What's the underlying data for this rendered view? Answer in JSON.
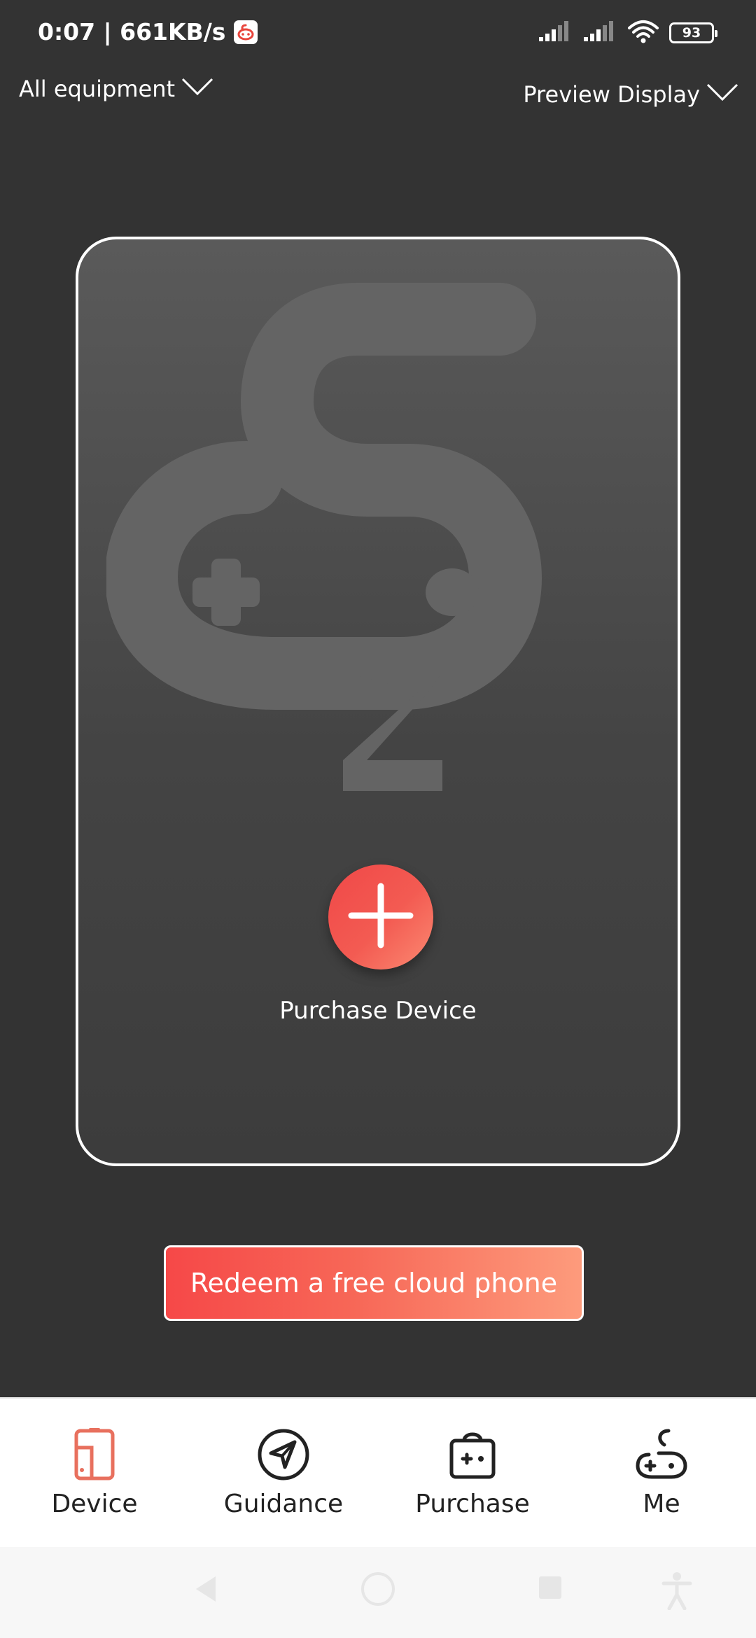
{
  "status_bar": {
    "time_speed": "0:07 | 661KB/s",
    "battery": "93"
  },
  "top_bar": {
    "equipment_filter": "All equipment",
    "display_mode": "Preview Display"
  },
  "device_card": {
    "add_label": "Purchase Device"
  },
  "redeem_button": {
    "label": "Redeem a free cloud phone"
  },
  "tabs": [
    {
      "label": "Device",
      "icon": "phone-icon",
      "active": true
    },
    {
      "label": "Guidance",
      "icon": "navigation-icon",
      "active": false
    },
    {
      "label": "Purchase",
      "icon": "shopping-bag-icon",
      "active": false
    },
    {
      "label": "Me",
      "icon": "gamepad-logo-icon",
      "active": false
    }
  ],
  "colors": {
    "background": "#333333",
    "accent_start": "#f64848",
    "accent_end": "#fd9b7c",
    "active_tab": "#e8705e",
    "tab_bar": "#ffffff"
  }
}
